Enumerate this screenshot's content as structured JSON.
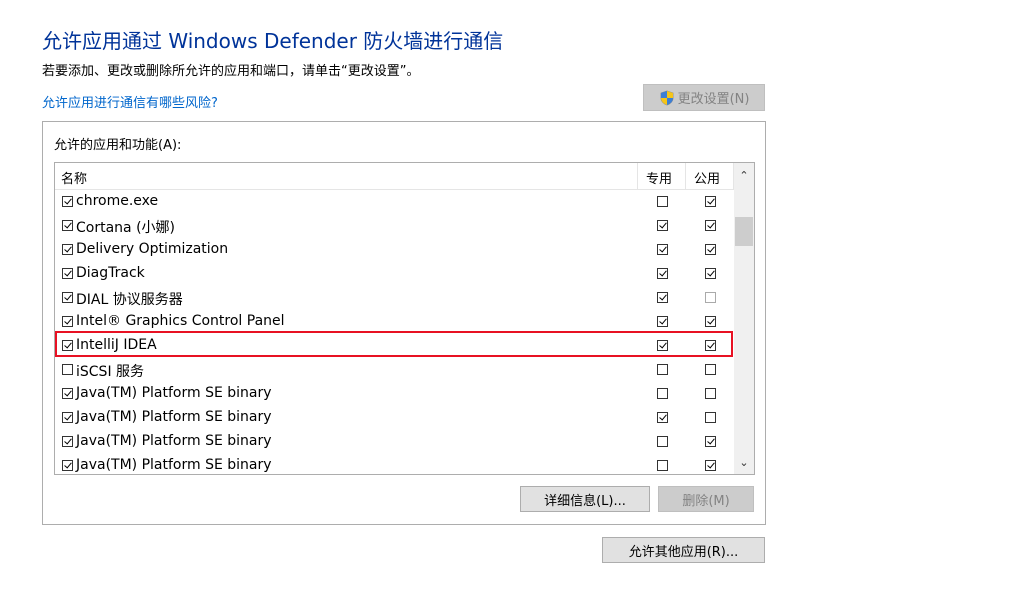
{
  "header": {
    "title": "允许应用通过 Windows Defender 防火墙进行通信",
    "subtitle": "若要添加、更改或删除所允许的应用和端口，请单击“更改设置”。",
    "risk_link": "允许应用进行通信有哪些风险?",
    "change_settings_label": "更改设置(N)"
  },
  "panel": {
    "label": "允许的应用和功能(A):",
    "columns": {
      "name": "名称",
      "private": "专用",
      "public": "公用"
    },
    "rows": [
      {
        "name": "chrome.exe",
        "enabled": true,
        "private": false,
        "public": true
      },
      {
        "name": "Cortana (小娜)",
        "enabled": true,
        "private": true,
        "public": true
      },
      {
        "name": "Delivery Optimization",
        "enabled": true,
        "private": true,
        "public": true
      },
      {
        "name": "DiagTrack",
        "enabled": true,
        "private": true,
        "public": true
      },
      {
        "name": "DIAL 协议服务器",
        "enabled": true,
        "private": true,
        "public": false
      },
      {
        "name": "Intel® Graphics Control Panel",
        "enabled": true,
        "private": true,
        "public": true
      },
      {
        "name": "IntelliJ IDEA",
        "enabled": true,
        "private": true,
        "public": true
      },
      {
        "name": "iSCSI 服务",
        "enabled": false,
        "private": false,
        "public": false
      },
      {
        "name": "Java(TM) Platform SE binary",
        "enabled": true,
        "private": false,
        "public": false
      },
      {
        "name": "Java(TM) Platform SE binary",
        "enabled": true,
        "private": true,
        "public": false
      },
      {
        "name": "Java(TM) Platform SE binary",
        "enabled": true,
        "private": false,
        "public": true
      },
      {
        "name": "Java(TM) Platform SE binary",
        "enabled": true,
        "private": false,
        "public": true
      }
    ],
    "details_label": "详细信息(L)...",
    "delete_label": "删除(M)"
  },
  "footer": {
    "allow_other_label": "允许其他应用(R)..."
  }
}
